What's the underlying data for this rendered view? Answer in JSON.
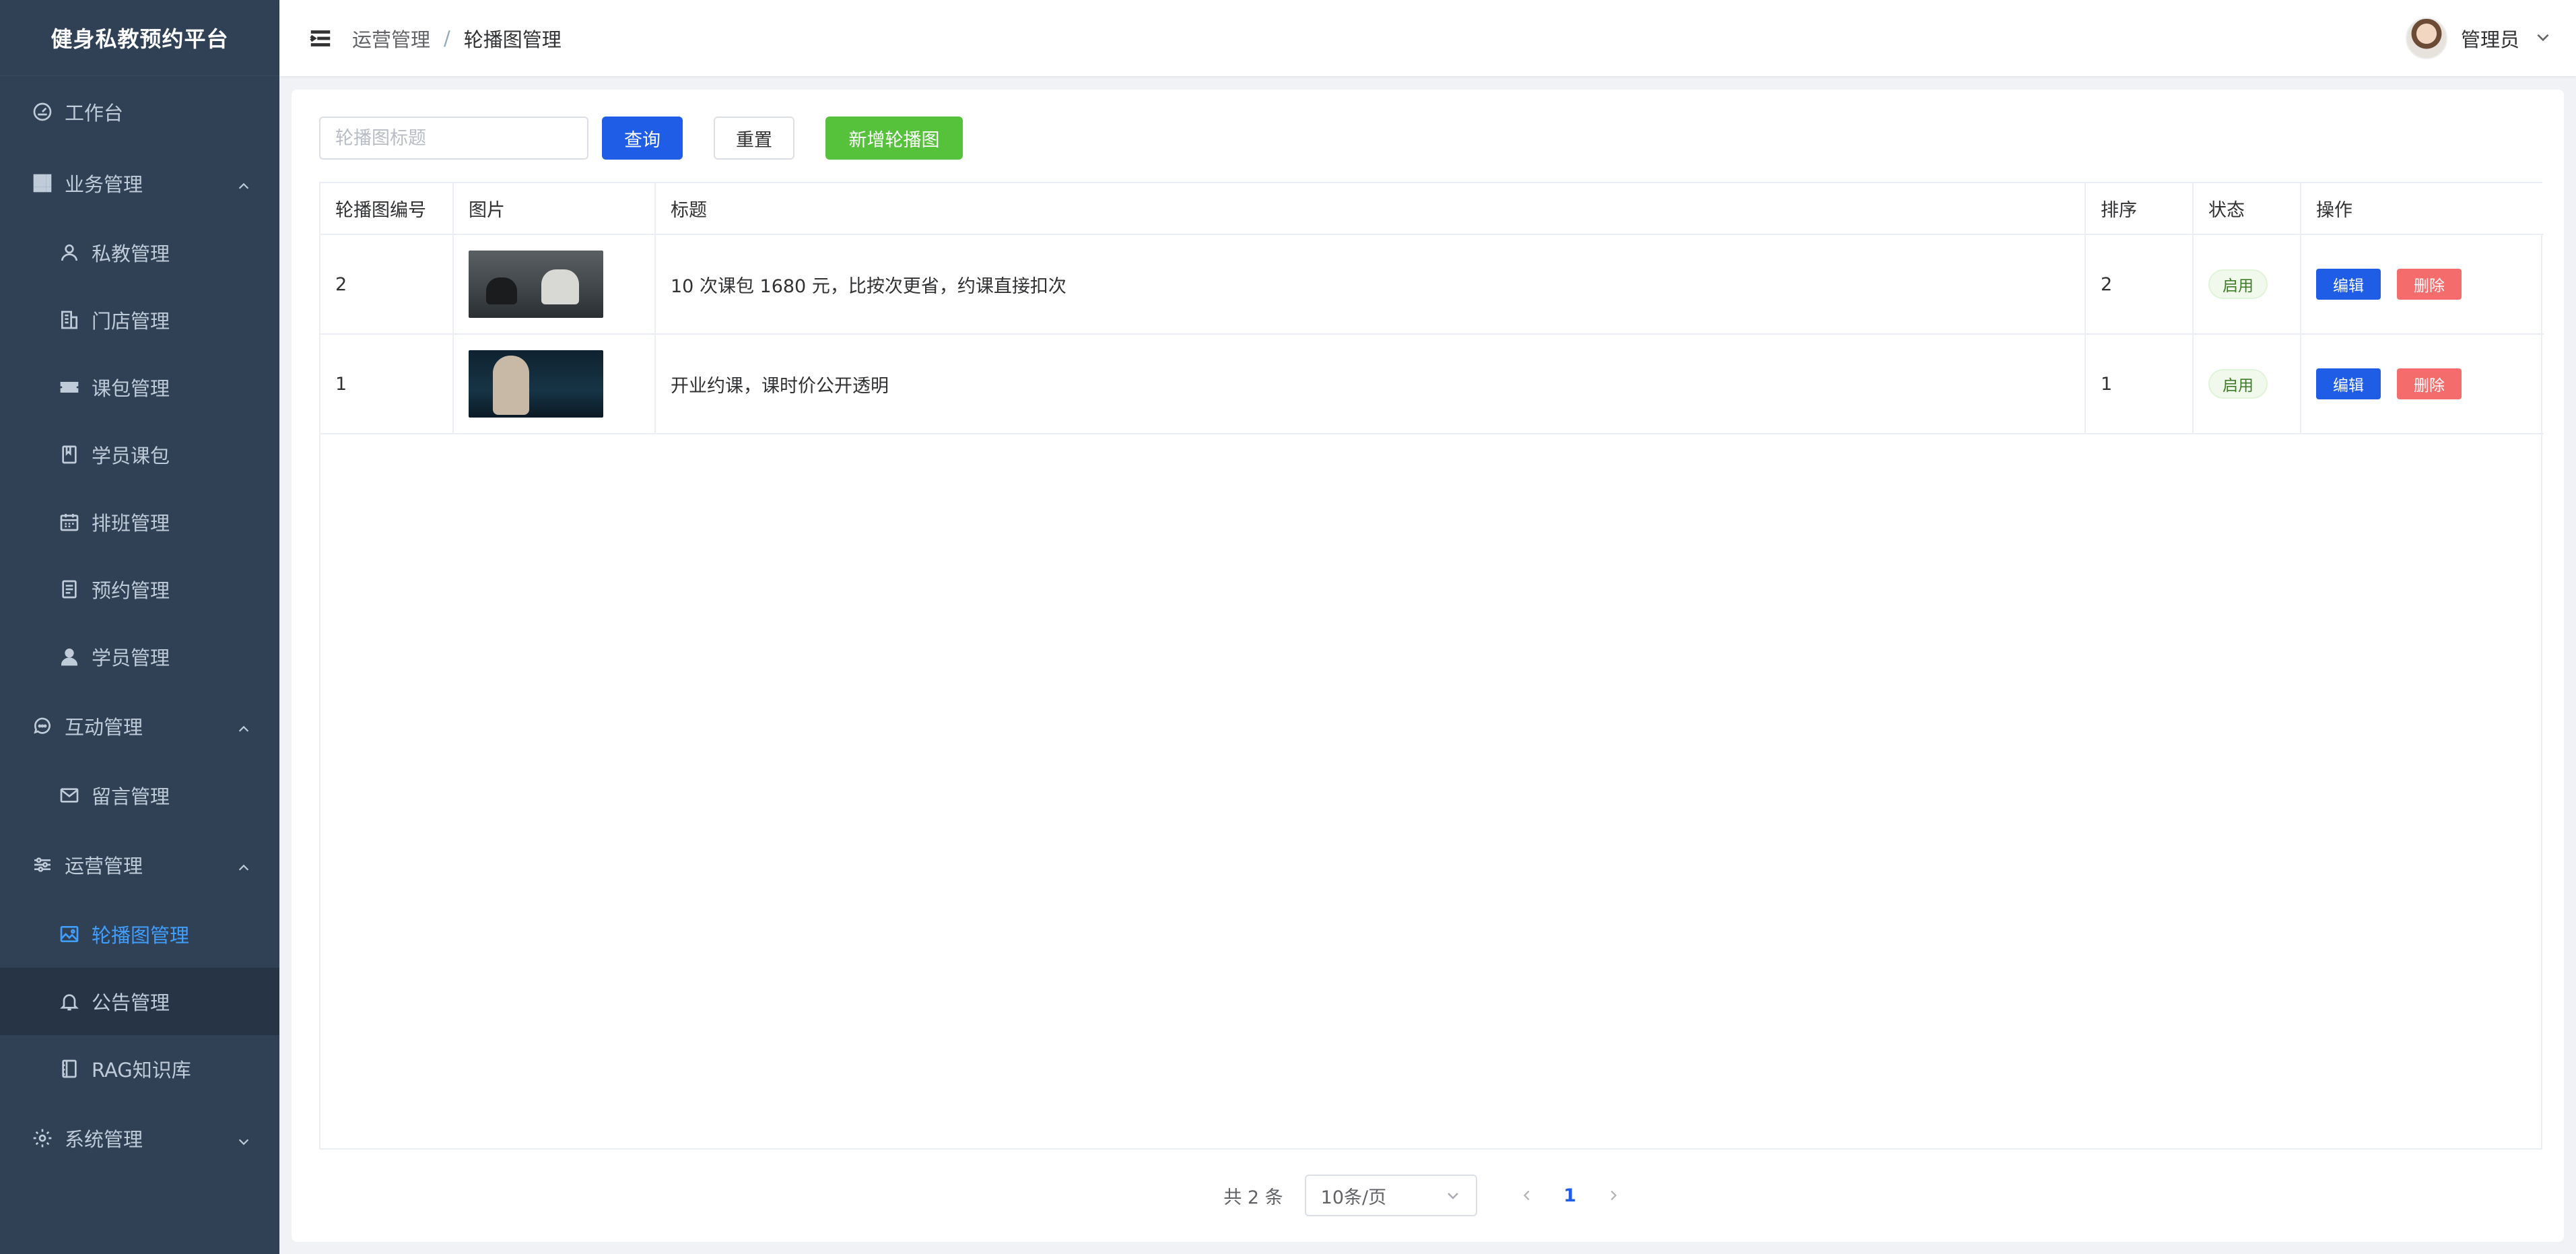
{
  "app": {
    "title": "健身私教预约平台"
  },
  "sidebar": {
    "items": [
      {
        "label": "工作台",
        "icon": "dashboard-icon",
        "level": "top"
      },
      {
        "label": "业务管理",
        "icon": "grid-icon",
        "level": "top",
        "expanded": true
      },
      {
        "label": "私教管理",
        "icon": "user-icon",
        "level": "sub"
      },
      {
        "label": "门店管理",
        "icon": "building-icon",
        "level": "sub"
      },
      {
        "label": "课包管理",
        "icon": "ticket-icon",
        "level": "sub"
      },
      {
        "label": "学员课包",
        "icon": "book-icon",
        "level": "sub"
      },
      {
        "label": "排班管理",
        "icon": "calendar-icon",
        "level": "sub"
      },
      {
        "label": "预约管理",
        "icon": "document-icon",
        "level": "sub"
      },
      {
        "label": "学员管理",
        "icon": "person-icon",
        "level": "sub"
      },
      {
        "label": "互动管理",
        "icon": "chat-icon",
        "level": "top",
        "expanded": true
      },
      {
        "label": "留言管理",
        "icon": "mail-icon",
        "level": "sub"
      },
      {
        "label": "运营管理",
        "icon": "sliders-icon",
        "level": "top",
        "expanded": true
      },
      {
        "label": "轮播图管理",
        "icon": "image-icon",
        "level": "sub",
        "active": true
      },
      {
        "label": "公告管理",
        "icon": "bell-icon",
        "level": "sub",
        "hover": true
      },
      {
        "label": "RAG知识库",
        "icon": "notebook-icon",
        "level": "sub"
      },
      {
        "label": "系统管理",
        "icon": "gear-icon",
        "level": "top",
        "expanded": false
      }
    ]
  },
  "header": {
    "breadcrumb": [
      "运营管理",
      "轮播图管理"
    ],
    "separator": "/",
    "username": "管理员"
  },
  "toolbar": {
    "search_placeholder": "轮播图标题",
    "search_value": "",
    "query_label": "查询",
    "reset_label": "重置",
    "add_label": "新增轮播图"
  },
  "table": {
    "columns": [
      "轮播图编号",
      "图片",
      "标题",
      "排序",
      "状态",
      "操作"
    ],
    "rows": [
      {
        "id": "2",
        "title": "10 次课包 1680 元，比按次更省，约课直接扣次",
        "sort": "2",
        "status": "启用",
        "edit": "编辑",
        "delete": "删除"
      },
      {
        "id": "1",
        "title": "开业约课，课时价公开透明",
        "sort": "1",
        "status": "启用",
        "edit": "编辑",
        "delete": "删除"
      }
    ]
  },
  "pagination": {
    "total_text": "共 2 条",
    "page_size": "10条/页",
    "current_page": "1"
  },
  "colors": {
    "sidebar_bg": "#304156",
    "active": "#409eff",
    "primary": "#1f5de6",
    "success": "#56c13b",
    "danger": "#f56c6c"
  }
}
